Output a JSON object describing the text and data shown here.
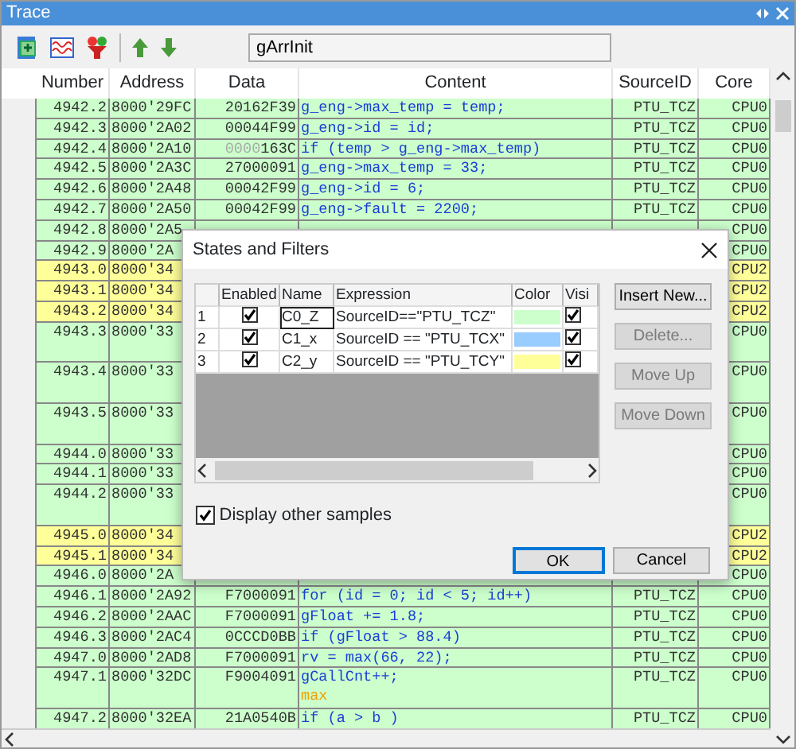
{
  "window": {
    "title": "Trace"
  },
  "toolbar": {
    "search": {
      "value": "gArrInit"
    }
  },
  "table": {
    "columns": [
      "Number",
      "Address",
      "Data",
      "Content",
      "SourceID",
      "Core"
    ],
    "rows": [
      {
        "number": "4942.2",
        "address": "8000'29FC",
        "data": "20162F39",
        "content": "g_eng->max_temp = temp;",
        "source": "PTU_TCZ",
        "core": "CPU0",
        "color": "#ccffcc",
        "tall": false
      },
      {
        "number": "4942.3",
        "address": "8000'2A02",
        "data": "00044F99",
        "content": "g_eng->id = id;",
        "source": "PTU_TCZ",
        "core": "CPU0",
        "color": "#ccffcc",
        "tall": false
      },
      {
        "number": "4942.4",
        "address": "8000'2A10",
        "data_prefix": "0000",
        "data": "163C",
        "content": "if (temp > g_eng->max_temp)",
        "source": "PTU_TCZ",
        "core": "CPU0",
        "color": "#ccffcc",
        "tall": false
      },
      {
        "number": "4942.5",
        "address": "8000'2A3C",
        "data": "27000091",
        "content": "g_eng->max_temp = 33;",
        "source": "PTU_TCZ",
        "core": "CPU0",
        "color": "#ccffcc",
        "tall": false
      },
      {
        "number": "4942.6",
        "address": "8000'2A48",
        "data": "00042F99",
        "content": "g_eng->id = 6;",
        "source": "PTU_TCZ",
        "core": "CPU0",
        "color": "#ccffcc",
        "tall": false
      },
      {
        "number": "4942.7",
        "address": "8000'2A50",
        "data": "00042F99",
        "content": "g_eng->fault = 2200;",
        "source": "PTU_TCZ",
        "core": "CPU0",
        "color": "#ccffcc",
        "tall": false
      },
      {
        "number": "4942.8",
        "address": "8000'2A5",
        "core": "CPU0",
        "color": "#ccffcc",
        "tall": false
      },
      {
        "number": "4942.9",
        "address": "8000'2A",
        "core": "CPU0",
        "color": "#ccffcc",
        "tall": false
      },
      {
        "number": "4943.0",
        "address": "8000'34",
        "core": "CPU2",
        "color": "#ffff99",
        "tall": false
      },
      {
        "number": "4943.1",
        "address": "8000'34",
        "core": "CPU2",
        "color": "#ffff99",
        "tall": false
      },
      {
        "number": "4943.2",
        "address": "8000'34",
        "core": "CPU2",
        "color": "#ffff99",
        "tall": false
      },
      {
        "number": "4943.3",
        "address": "8000'33",
        "core": "CPU0",
        "color": "#ccffcc",
        "tall": true
      },
      {
        "number": "4943.4",
        "address": "8000'33",
        "core": "CPU0",
        "color": "#ccffcc",
        "tall": true
      },
      {
        "number": "4943.5",
        "address": "8000'33",
        "core": "CPU0",
        "color": "#ccffcc",
        "tall": true
      },
      {
        "number": "4944.0",
        "address": "8000'33",
        "core": "CPU0",
        "color": "#ccffcc",
        "tall": false
      },
      {
        "number": "4944.1",
        "address": "8000'33",
        "core": "CPU0",
        "color": "#ccffcc",
        "tall": false
      },
      {
        "number": "4944.2",
        "address": "8000'33",
        "core": "CPU0",
        "color": "#ccffcc",
        "tall": true
      },
      {
        "number": "4945.0",
        "address": "8000'34",
        "core": "CPU2",
        "color": "#ffff99",
        "tall": false
      },
      {
        "number": "4945.1",
        "address": "8000'34",
        "core": "CPU2",
        "color": "#ffff99",
        "tall": false
      },
      {
        "number": "4946.0",
        "address": "8000'2A",
        "core": "CPU0",
        "color": "#ccffcc",
        "tall": false
      },
      {
        "number": "4946.1",
        "address": "8000'2A92",
        "data": "F7000091",
        "content": "for (id = 0; id < 5; id++)",
        "source": "PTU_TCZ",
        "core": "CPU0",
        "color": "#ccffcc",
        "tall": false
      },
      {
        "number": "4946.2",
        "address": "8000'2AAC",
        "data": "F7000091",
        "content": "gFloat += 1.8;",
        "source": "PTU_TCZ",
        "core": "CPU0",
        "color": "#ccffcc",
        "tall": false
      },
      {
        "number": "4946.3",
        "address": "8000'2AC4",
        "data": "0CCCD0BB",
        "content": "if (gFloat > 88.4)",
        "source": "PTU_TCZ",
        "core": "CPU0",
        "color": "#ccffcc",
        "tall": false
      },
      {
        "number": "4947.0",
        "address": "8000'2AD8",
        "data": "F7000091",
        "content": "rv = max(66, 22);",
        "source": "PTU_TCZ",
        "core": "CPU0",
        "color": "#ccffcc",
        "tall": false
      },
      {
        "number": "4947.1",
        "address": "8000'32DC",
        "data": "F9004091",
        "content": "gCallCnt++;",
        "note": "max",
        "source": "PTU_TCZ",
        "core": "CPU0",
        "color": "#ccffcc",
        "tall": true
      },
      {
        "number": "4947.2",
        "address": "8000'32EA",
        "data": "21A0540B",
        "content": "if (a > b )",
        "source": "PTU_TCZ",
        "core": "CPU0",
        "color": "#ccffcc",
        "tall": false
      }
    ]
  },
  "dialog": {
    "title": "States and Filters",
    "columns": [
      "Enabled",
      "Name",
      "Expression",
      "Color",
      "Visi"
    ],
    "filters": [
      {
        "index": "1",
        "enabled": true,
        "name": "C0_Z",
        "expression": "SourceID==\"PTU_TCZ\"",
        "color": "#ccffcc",
        "visible": true,
        "selected": true
      },
      {
        "index": "2",
        "enabled": true,
        "name": "C1_x",
        "expression": "SourceID == \"PTU_TCX\"",
        "color": "#99ccff",
        "visible": true,
        "selected": false
      },
      {
        "index": "3",
        "enabled": true,
        "name": "C2_y",
        "expression": "SourceID == \"PTU_TCY\"",
        "color": "#ffff99",
        "visible": true,
        "selected": false
      }
    ],
    "side_buttons": [
      {
        "label": "Insert New...",
        "disabled": false
      },
      {
        "label": "Delete...",
        "disabled": true
      },
      {
        "label": "Move Up",
        "disabled": true
      },
      {
        "label": "Move Down",
        "disabled": true
      }
    ],
    "display_other_samples": {
      "label": "Display other samples",
      "checked": true
    },
    "buttons": [
      {
        "label": "OK",
        "default": true
      },
      {
        "label": "Cancel",
        "default": false
      }
    ]
  }
}
